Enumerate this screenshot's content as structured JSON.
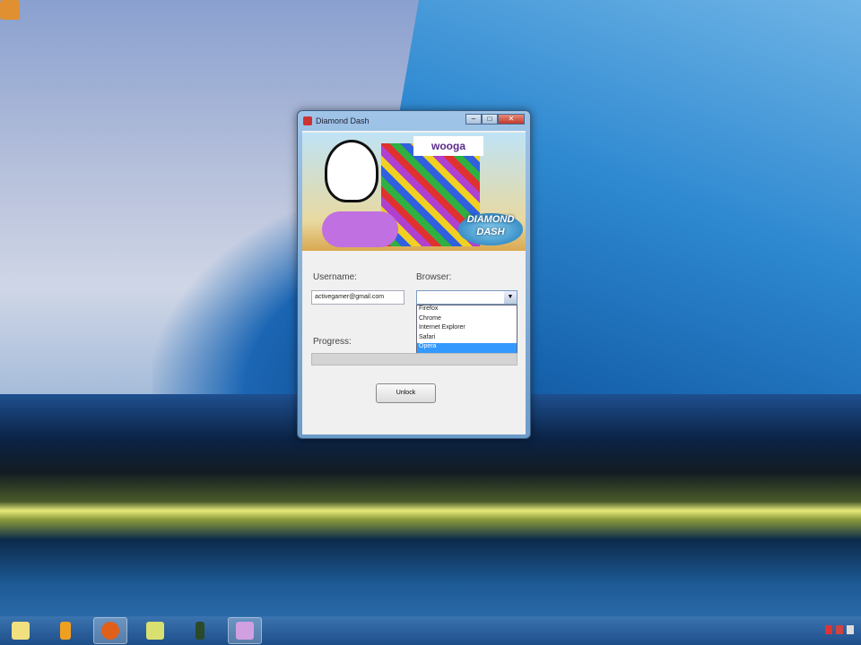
{
  "window": {
    "title": "Diamond Dash",
    "minimize": "–",
    "maximize": "□",
    "close": "✕"
  },
  "banner": {
    "brand": "wooga",
    "logo_line1": "DIAMOND",
    "logo_line2": "DASH"
  },
  "form": {
    "username_label": "Username:",
    "username_value": "activegamer@gmail.com",
    "browser_label": "Browser:",
    "browser_value": "",
    "browser_options": [
      "Firefox",
      "Chrome",
      "Internet Explorer",
      "Safari",
      "Opera"
    ],
    "browser_highlighted": "Opera",
    "progress_label": "Progress:",
    "progress_value": 0,
    "unlock_label": "Unlock"
  },
  "taskbar": {
    "items": [
      "explorer",
      "media-player",
      "firefox",
      "notes",
      "app",
      "diamond-dash"
    ]
  }
}
